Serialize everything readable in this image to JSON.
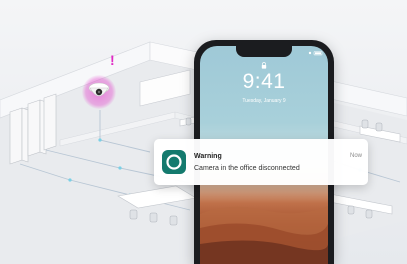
{
  "lockscreen": {
    "time": "9:41",
    "date": "Tuesday, January 9"
  },
  "notification": {
    "title": "Warning",
    "message": "Camera in the office disconnected",
    "time": "Now",
    "icon": "camera-app-icon",
    "icon_color": "#147a6e"
  },
  "alert": {
    "symbol": "!",
    "color": "#e02bc4"
  }
}
